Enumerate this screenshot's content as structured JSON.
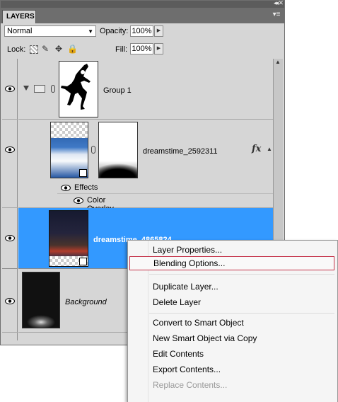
{
  "panel": {
    "tab_label": "LAYERS",
    "blend_mode": "Normal",
    "opacity_label": "Opacity:",
    "opacity_value": "100%",
    "lock_label": "Lock:",
    "fill_label": "Fill:",
    "fill_value": "100%"
  },
  "layers": {
    "group": {
      "name": "Group 1"
    },
    "dreamstime1": {
      "name": "dreamstime_2592311",
      "effects_label": "Effects",
      "overlay_label": "Color Overlay"
    },
    "dreamstime2": {
      "name": "dreamstime_4865824"
    },
    "background": {
      "name": "Background"
    }
  },
  "context_menu": {
    "items": [
      {
        "label": "Layer Properties...",
        "enabled": true
      },
      {
        "label": "Blending Options...",
        "enabled": true,
        "highlighted": true
      },
      {
        "label": "Duplicate Layer...",
        "enabled": true
      },
      {
        "label": "Delete Layer",
        "enabled": true
      },
      {
        "label": "Convert to Smart Object",
        "enabled": true
      },
      {
        "label": "New Smart Object via Copy",
        "enabled": true
      },
      {
        "label": "Edit Contents",
        "enabled": true
      },
      {
        "label": "Export Contents...",
        "enabled": true
      },
      {
        "label": "Replace Contents...",
        "enabled": false
      }
    ]
  },
  "colors": {
    "selection": "#3399ff",
    "menu_highlight_border": "#c43148",
    "panel_bg": "#d6d6d6"
  },
  "icons": [
    "eye-icon",
    "folder-icon",
    "link-icon",
    "fx-icon",
    "lock-all-icon",
    "lock-position-icon",
    "lock-image-icon",
    "lock-transparent-icon",
    "panel-menu-icon"
  ]
}
